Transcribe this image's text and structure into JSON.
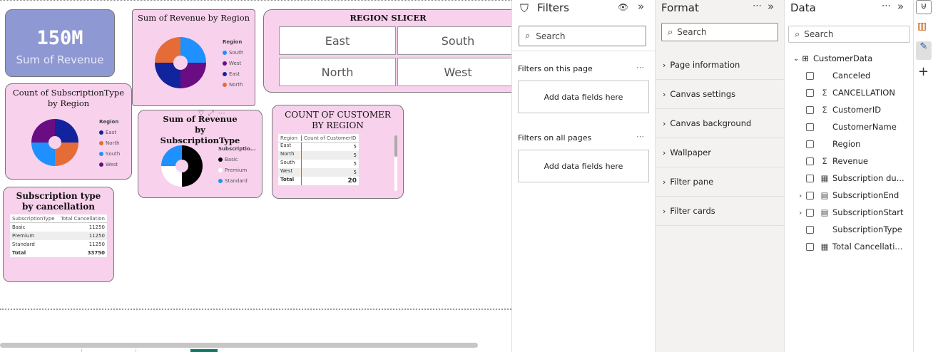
{
  "kpi": {
    "value": "150M",
    "label": "Sum of Revenue"
  },
  "revenue_by_region": {
    "title": "Sum of Revenue by Region",
    "legend_title": "Region",
    "legend": [
      "South",
      "West",
      "East",
      "North"
    ],
    "chart_data": {
      "type": "pie",
      "categories": [
        "South",
        "West",
        "East",
        "North"
      ],
      "values": [
        25,
        25,
        25,
        25
      ],
      "colors": [
        "#1e90ff",
        "#6a0d83",
        "#12239e",
        "#e66c37"
      ]
    }
  },
  "slicer": {
    "title": "REGION SLICER",
    "items": [
      "East",
      "South",
      "North",
      "West"
    ]
  },
  "subs_by_region": {
    "title": "Count of SubscriptionType by Region",
    "legend_title": "Region",
    "legend": [
      "East",
      "North",
      "South",
      "West"
    ],
    "chart_data": {
      "type": "pie",
      "categories": [
        "East",
        "North",
        "South",
        "West"
      ],
      "values": [
        25,
        25,
        25,
        25
      ],
      "colors": [
        "#12239e",
        "#e66c37",
        "#1e90ff",
        "#6a0d83"
      ]
    }
  },
  "rev_by_subtype": {
    "title": "Sum of Revenue by SubscriptionType",
    "legend_title": "Subscriptio...",
    "legend": [
      "Basic",
      "Premium",
      "Standard"
    ],
    "chart_data": {
      "type": "pie",
      "categories": [
        "Basic",
        "Premium",
        "Standard"
      ],
      "values": [
        50,
        25,
        25
      ],
      "colors": [
        "#000000",
        "#ffffff",
        "#1e90ff"
      ]
    }
  },
  "cust_by_region": {
    "title": "COUNT OF CUSTOMER BY REGION",
    "headers": [
      "Region",
      "Count of CustomerID"
    ],
    "rows": [
      [
        "East",
        "5"
      ],
      [
        "North",
        "5"
      ],
      [
        "South",
        "5"
      ],
      [
        "West",
        "5"
      ]
    ],
    "total": [
      "Total",
      "20"
    ]
  },
  "subtype_cancel": {
    "title": "Subscription type by cancellation",
    "headers": [
      "SubscriptionType",
      "Total Cancellation"
    ],
    "rows": [
      [
        "Basic",
        "11250"
      ],
      [
        "Premium",
        "11250"
      ],
      [
        "Standard",
        "11250"
      ]
    ],
    "total": [
      "Total",
      "33750"
    ]
  },
  "filters": {
    "title": "Filters",
    "search_placeholder": "Search",
    "on_page": "Filters on this page",
    "on_all": "Filters on all pages",
    "add": "Add data fields here"
  },
  "format": {
    "title": "Format",
    "search_placeholder": "Search",
    "items": [
      "Page information",
      "Canvas settings",
      "Canvas background",
      "Wallpaper",
      "Filter pane",
      "Filter cards"
    ]
  },
  "data": {
    "title": "Data",
    "search_placeholder": "Search",
    "table": "CustomerData",
    "fields": [
      {
        "name": "Canceled",
        "icon": "",
        "expand": false
      },
      {
        "name": "CANCELLATION",
        "icon": "Σ",
        "expand": false
      },
      {
        "name": "CustomerID",
        "icon": "Σ",
        "expand": false
      },
      {
        "name": "CustomerName",
        "icon": "",
        "expand": false
      },
      {
        "name": "Region",
        "icon": "",
        "expand": false
      },
      {
        "name": "Revenue",
        "icon": "Σ",
        "expand": false
      },
      {
        "name": "Subscription du...",
        "icon": "▦",
        "expand": false
      },
      {
        "name": "SubscriptionEnd",
        "icon": "▤",
        "expand": true
      },
      {
        "name": "SubscriptionStart",
        "icon": "▤",
        "expand": true
      },
      {
        "name": "SubscriptionType",
        "icon": "",
        "expand": false
      },
      {
        "name": "Total Cancellati...",
        "icon": "▦",
        "expand": false
      }
    ]
  }
}
